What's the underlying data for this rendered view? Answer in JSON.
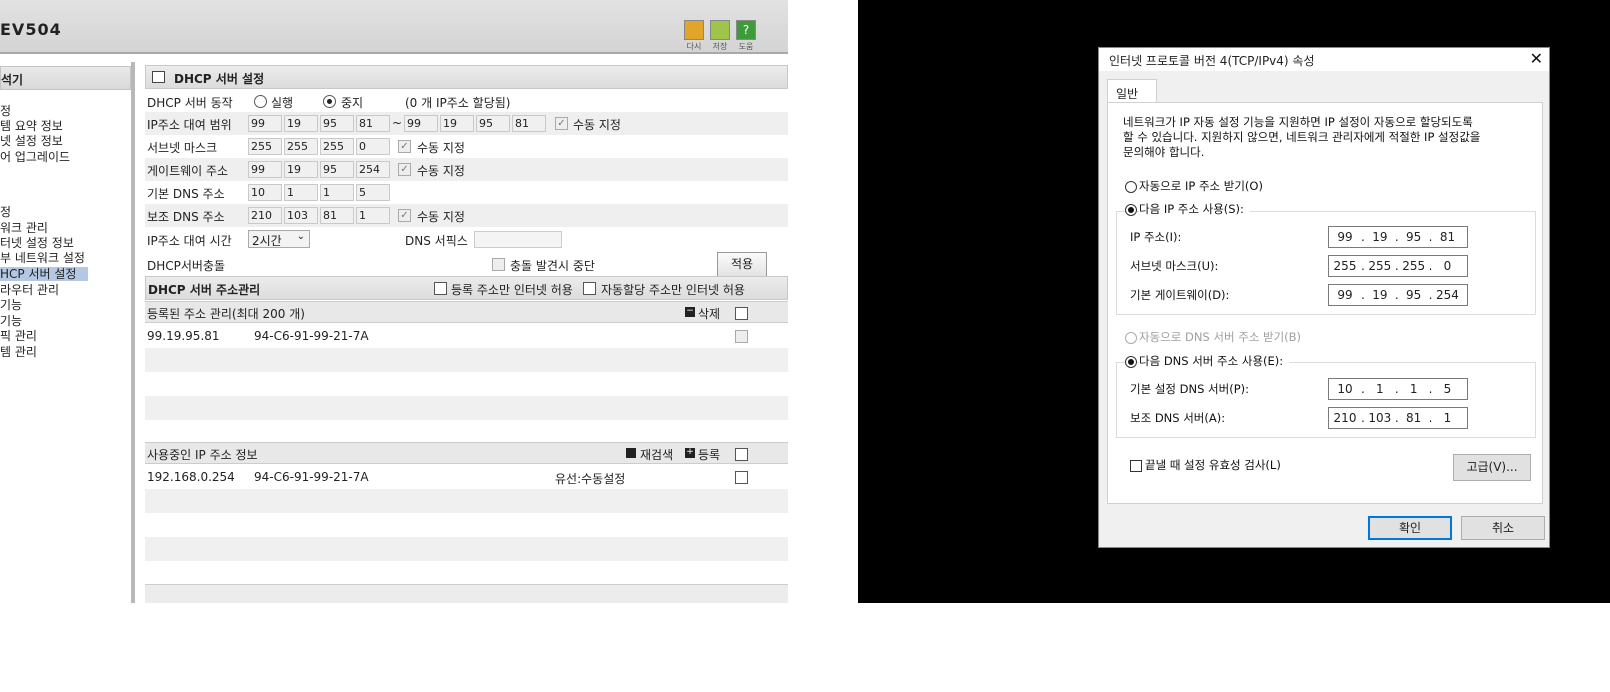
{
  "router": {
    "logo": "EV504",
    "toolbar": [
      {
        "label": "다시",
        "icon": "refresh-icon",
        "color": "#e2a52b"
      },
      {
        "label": "저장",
        "icon": "save-icon",
        "color": "#9ec54a"
      },
      {
        "label": "도움",
        "icon": "help-icon",
        "color": "#3f9b3a"
      }
    ],
    "sidebar": {
      "head": "석기",
      "items": [
        "정",
        "템 요약 정보",
        "넷 설정 정보",
        "어 업그레이드",
        "정",
        "워크 관리",
        "터넷 설정 정보",
        "부 네트워크 설정",
        "HCP 서버 설정",
        "라우터 관리",
        "기능",
        "기능",
        "픽 관리",
        "템 관리"
      ]
    },
    "dhcp": {
      "section_title": "DHCP 서버 설정",
      "operation_label": "DHCP 서버 동작",
      "run_label": "실행",
      "stop_label": "중지",
      "status": "(0 개 IP주소 할당됨)",
      "range_label": "IP주소 대여 범위",
      "range_start": [
        "99",
        "19",
        "95",
        "81"
      ],
      "range_end": [
        "99",
        "19",
        "95",
        "81"
      ],
      "range_sep": "~",
      "manual_label": "수동 지정",
      "subnet_label": "서브넷 마스크",
      "subnet": [
        "255",
        "255",
        "255",
        "0"
      ],
      "gateway_label": "게이트웨이 주소",
      "gateway": [
        "99",
        "19",
        "95",
        "254"
      ],
      "dns1_label": "기본 DNS 주소",
      "dns1": [
        "10",
        "1",
        "1",
        "5"
      ],
      "dns2_label": "보조 DNS 주소",
      "dns2": [
        "210",
        "103",
        "81",
        "1"
      ],
      "lease_label": "IP주소 대여 시간",
      "lease_value": "2시간",
      "dns_suffix_label": "DNS 서픽스",
      "conflict_label": "DHCP서버충돌",
      "conflict_stop_label": "충돌 발견시 중단",
      "apply_label": "적용"
    },
    "addr_mgmt": {
      "section_title": "DHCP 서버 주소관리",
      "only_registered_label": "등록 주소만 인터넷 허용",
      "only_auto_label": "자동할당 주소만 인터넷 허용",
      "registered_title": "등록된 주소 관리(최대 200 개)",
      "delete_label": "삭제",
      "registered_rows": [
        {
          "ip": "99.19.95.81",
          "mac": "94-C6-91-99-21-7A"
        }
      ],
      "inuse_title": "사용중인 IP 주소 정보",
      "rescan_label": "재검색",
      "register_label": "등록",
      "inuse_rows": [
        {
          "ip": "192.168.0.254",
          "mac": "94-C6-91-99-21-7A",
          "type": "유선:수동설정"
        }
      ]
    }
  },
  "dialog": {
    "title": "인터넷 프로토콜 버전 4(TCP/IPv4) 속성",
    "tab": "일반",
    "description": [
      "네트워크가 IP 자동 설정 기능을 지원하면 IP 설정이 자동으로 할당되도록",
      "할 수 있습니다. 지원하지 않으면, 네트워크 관리자에게 적절한 IP 설정값을",
      "문의해야 합니다."
    ],
    "auto_ip_label": "자동으로 IP 주소 받기(O)",
    "manual_ip_label": "다음 IP 주소 사용(S):",
    "ip_label": "IP 주소(I):",
    "ip": [
      "99",
      "19",
      "95",
      "81"
    ],
    "subnet_label": "서브넷 마스크(U):",
    "subnet": [
      "255",
      "255",
      "255",
      "0"
    ],
    "gateway_label": "기본 게이트웨이(D):",
    "gateway": [
      "99",
      "19",
      "95",
      "254"
    ],
    "auto_dns_label": "자동으로 DNS 서버 주소 받기(B)",
    "manual_dns_label": "다음 DNS 서버 주소 사용(E):",
    "dns1_label": "기본 설정 DNS 서버(P):",
    "dns1": [
      "10",
      "1",
      "1",
      "5"
    ],
    "dns2_label": "보조 DNS 서버(A):",
    "dns2": [
      "210",
      "103",
      "81",
      "1"
    ],
    "validate_label": "끝낼 때 설정 유효성 검사(L)",
    "advanced_label": "고급(V)...",
    "ok_label": "확인",
    "cancel_label": "취소"
  }
}
